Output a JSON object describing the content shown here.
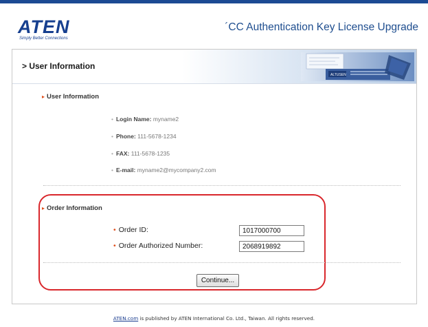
{
  "header": {
    "logo_text": "ATEN",
    "logo_slogan": "Simply Better Connections",
    "app_title": "´CC Authentication Key License Upgrade"
  },
  "section": {
    "title": "> User Information",
    "banner_text": "ALTUSEN"
  },
  "user_info": {
    "heading": "User Information",
    "rows": [
      {
        "label": "Login Name:",
        "value": "myname2"
      },
      {
        "label": "Phone:",
        "value": "111-5678-1234"
      },
      {
        "label": "FAX:",
        "value": "111-5678-1235"
      },
      {
        "label": "E-mail:",
        "value": "myname2@mycompany2.com"
      }
    ]
  },
  "order_info": {
    "heading": "Order Information",
    "order_id_label": "Order ID:",
    "order_id_value": "1017000700",
    "auth_number_label": "Order Authorized Number:",
    "auth_number_value": "2068919892",
    "continue_label": "Continue..."
  },
  "footer": {
    "link_text": "ATEN.com",
    "text": " is published by ATEN International Co. Ltd., Taiwan. All rights reserved."
  },
  "colors": {
    "brand_blue": "#163f8f",
    "highlight_red": "#d9262b",
    "bullet_orange": "#e04e1b"
  }
}
